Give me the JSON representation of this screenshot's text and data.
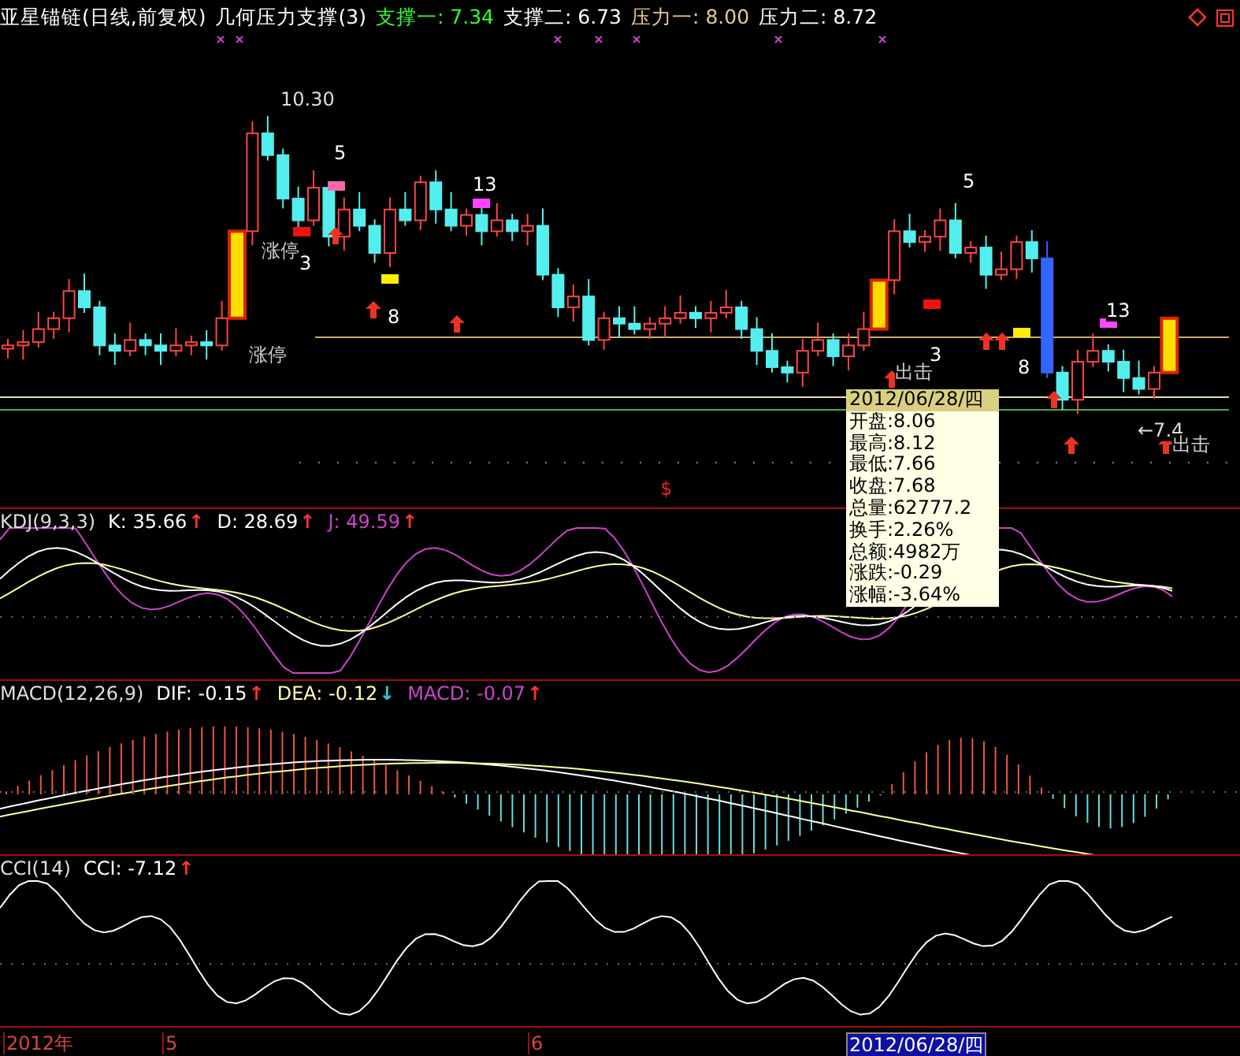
{
  "header": {
    "title": "亚星锚链(日线,前复权)",
    "indicator": "几何压力支撑(3)",
    "values": [
      {
        "text": "支撑一: 7.34",
        "color": "#33ff33"
      },
      {
        "text": "支撑二: 6.73",
        "color": "#ffffff"
      },
      {
        "text": "压力一: 8.00",
        "color": "#e8c890"
      },
      {
        "text": "压力二: 8.72",
        "color": "#ffffff"
      }
    ]
  },
  "price_chart": {
    "annotations": [
      {
        "text": "10.30",
        "kind": "price"
      },
      {
        "text": "5",
        "kind": "count"
      },
      {
        "text": "13",
        "kind": "count"
      },
      {
        "text": "3",
        "kind": "count"
      },
      {
        "text": "8",
        "kind": "count"
      },
      {
        "text": "涨停",
        "kind": "signal"
      },
      {
        "text": "涨停",
        "kind": "signal"
      },
      {
        "text": "5",
        "kind": "count"
      },
      {
        "text": "3",
        "kind": "count"
      },
      {
        "text": "8",
        "kind": "count"
      },
      {
        "text": "13",
        "kind": "count"
      },
      {
        "text": "出击",
        "kind": "signal"
      },
      {
        "text": "←7.4",
        "kind": "price"
      },
      {
        "text": "出击",
        "kind": "signal"
      },
      {
        "text": "$",
        "kind": "mark"
      }
    ],
    "tooltip": {
      "date": "2012/06/28/四",
      "rows": [
        "开盘:8.06",
        "最高:8.12",
        "最低:7.66",
        "收盘:7.68",
        "总量:62777.2",
        "换手:2.26%",
        "总额:4982万",
        "涨跌:-0.29",
        "涨幅:-3.64%"
      ]
    }
  },
  "indicators": [
    {
      "kind": "kdj",
      "name": "KDJ(9,3,3)",
      "values": [
        {
          "text": "K: 35.66",
          "color": "#ffffff",
          "arrow": "↑",
          "rising": true
        },
        {
          "text": "D: 28.69",
          "color": "#ffffff",
          "arrow": "↑",
          "rising": true
        },
        {
          "text": "J: 49.59",
          "color": "#cc44cc",
          "arrow": "↑",
          "rising": true
        }
      ]
    },
    {
      "kind": "macd",
      "name": "MACD(12,26,9)",
      "values": [
        {
          "text": "DIF: -0.15",
          "color": "#ffffff",
          "arrow": "↑",
          "rising": true
        },
        {
          "text": "DEA: -0.12",
          "color": "#ffffaa",
          "arrow": "↓",
          "rising": false
        },
        {
          "text": "MACD: -0.07",
          "color": "#cc44cc",
          "arrow": "↑",
          "rising": true
        }
      ]
    },
    {
      "kind": "cci",
      "name": "CCI(14)",
      "values": [
        {
          "text": "CCI: -7.12",
          "color": "#ffffff",
          "arrow": "↑",
          "rising": true
        }
      ]
    }
  ],
  "time_axis": [
    {
      "text": "2012年",
      "selected": false
    },
    {
      "text": "5",
      "selected": false
    },
    {
      "text": "6",
      "selected": false
    },
    {
      "text": "2012/06/28/四",
      "selected": true
    }
  ]
}
